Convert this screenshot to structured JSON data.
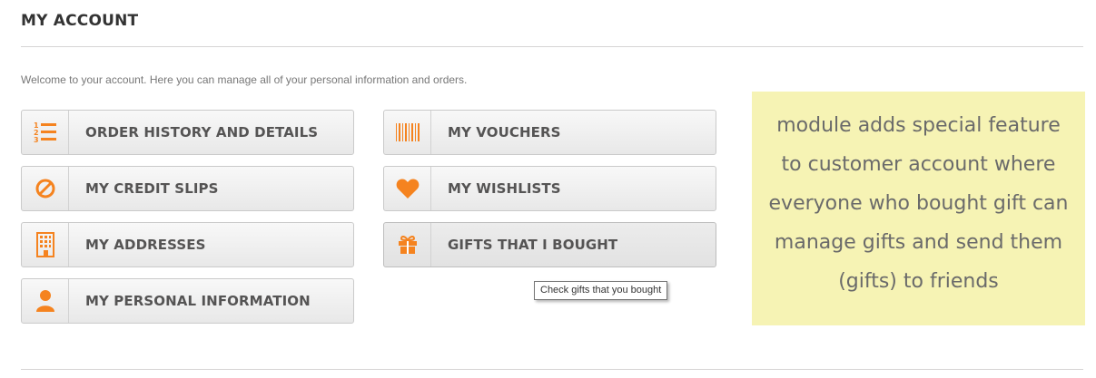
{
  "page": {
    "title": "MY ACCOUNT",
    "welcome": "Welcome to your account. Here you can manage all of your personal information and orders."
  },
  "accent_color": "#f5831f",
  "buttons": {
    "order_history": {
      "label": "ORDER HISTORY AND DETAILS",
      "icon": "ordered-list-icon"
    },
    "credit_slips": {
      "label": "MY CREDIT SLIPS",
      "icon": "ban-icon"
    },
    "addresses": {
      "label": "MY ADDRESSES",
      "icon": "building-icon"
    },
    "personal_info": {
      "label": "MY PERSONAL INFORMATION",
      "icon": "user-icon"
    },
    "vouchers": {
      "label": "MY VOUCHERS",
      "icon": "barcode-icon"
    },
    "wishlists": {
      "label": "MY WISHLISTS",
      "icon": "heart-icon"
    },
    "gifts": {
      "label": "GIFTS THAT I BOUGHT",
      "icon": "gift-icon"
    }
  },
  "tooltip": "Check gifts that you bought",
  "note": {
    "background": "#f6f3b4",
    "lines": [
      "module adds special feature",
      "to customer account where",
      "everyone who bought gift can",
      "manage gifts and send them",
      "(gifts) to friends"
    ]
  }
}
